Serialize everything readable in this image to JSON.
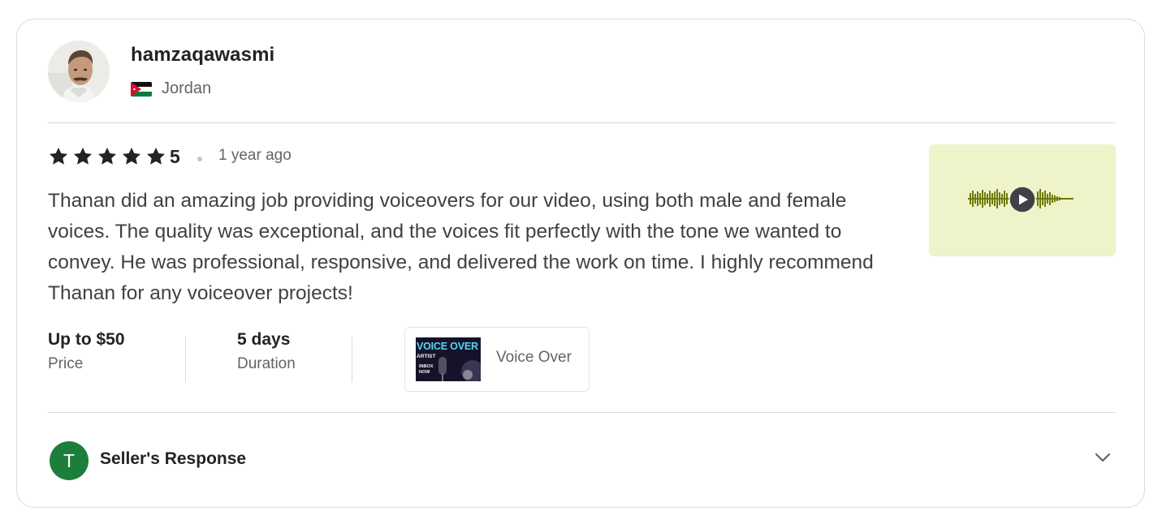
{
  "reviewer": {
    "username": "hamzaqawasmi",
    "country": "Jordan",
    "flag_icon": "jordan-flag-icon"
  },
  "review": {
    "rating": "5",
    "stars_filled": 5,
    "stars_total": 5,
    "time_ago": "1 year ago",
    "text": "Thanan did an amazing job providing voiceovers for our video, using both male and female voices. The quality was exceptional, and the voices fit perfectly with the tone we wanted to convey. He was professional, responsive, and delivered the work on time. I highly recommend Thanan for any voiceover projects!"
  },
  "media": {
    "type": "audio",
    "icon": "play-icon",
    "background_color": "#eef3c9",
    "waveform_color": "#6f7a0c"
  },
  "stats": [
    {
      "value": "Up to $50",
      "label": "Price"
    },
    {
      "value": "5 days",
      "label": "Duration"
    }
  ],
  "gig": {
    "title": "Voice Over",
    "thumbnail_text": "VOICE OVER",
    "thumbnail_subtext": "ARTIST",
    "thumbnail_badge": "INBOX NOW"
  },
  "seller_response": {
    "avatar_initial": "T",
    "avatar_color": "#1b7f3b",
    "label": "Seller's Response",
    "icon": "chevron-down-icon"
  },
  "colors": {
    "star": "#222325",
    "text_primary": "#222325",
    "text_secondary": "#62646a",
    "border": "#dadbdd"
  }
}
